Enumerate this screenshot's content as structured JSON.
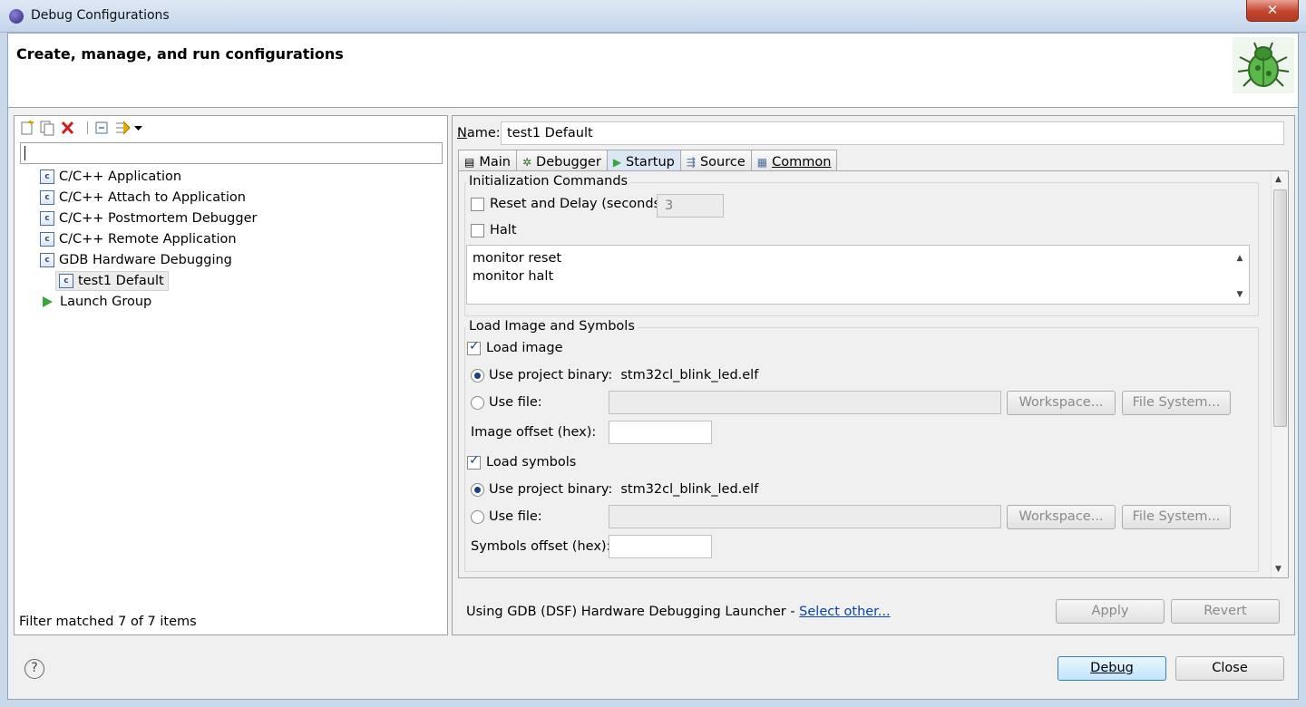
{
  "window": {
    "title": "Debug Configurations",
    "close_icon": "close-icon"
  },
  "banner": {
    "title": "Create, manage, and run configurations",
    "icon": "bug-icon"
  },
  "left_panel": {
    "toolbar": [
      "new-config-icon",
      "duplicate-icon",
      "delete-icon",
      "collapse-all-icon",
      "filter-icon",
      "dropdown-icon"
    ],
    "filter_value": "",
    "tree": [
      {
        "label": "C/C++ Application",
        "icon": "c-config-icon"
      },
      {
        "label": "C/C++ Attach to Application",
        "icon": "c-config-icon"
      },
      {
        "label": "C/C++ Postmortem Debugger",
        "icon": "c-config-icon"
      },
      {
        "label": "C/C++ Remote Application",
        "icon": "c-config-icon"
      },
      {
        "label": "GDB Hardware Debugging",
        "icon": "c-config-icon"
      },
      {
        "label": "test1 Default",
        "icon": "c-config-icon",
        "selected": true
      },
      {
        "label": "Launch Group",
        "icon": "launch-group-icon"
      }
    ],
    "status": "Filter matched 7 of 7 items"
  },
  "right_panel": {
    "name_label_mnemonic": "N",
    "name_label_rest": "ame:",
    "name_value": "test1 Default",
    "tabs": [
      {
        "label": "Main",
        "icon": "main-tab-icon"
      },
      {
        "label": "Debugger",
        "icon": "debugger-tab-icon"
      },
      {
        "label": "Startup",
        "icon": "startup-tab-icon",
        "active": true
      },
      {
        "label": "Source",
        "icon": "source-tab-icon"
      },
      {
        "label": "Common",
        "icon": "common-tab-icon"
      }
    ],
    "init": {
      "title": "Initialization Commands",
      "reset_label": "Reset and Delay (seconds):",
      "reset_checked": false,
      "delay_value": "3",
      "halt_label": "Halt",
      "halt_checked": false,
      "commands": [
        "monitor reset",
        "monitor halt"
      ]
    },
    "load": {
      "title": "Load Image and Symbols",
      "load_image_label": "Load image",
      "load_image_checked": true,
      "use_project_binary_label": "Use project binary:",
      "image_binary": "stm32cl_blink_led.elf",
      "use_file_label": "Use file:",
      "workspace_label": "Workspace...",
      "filesystem_label": "File System...",
      "image_offset_label": "Image offset (hex):",
      "image_offset_value": "",
      "load_symbols_label": "Load symbols",
      "load_symbols_checked": true,
      "symbols_binary": "stm32cl_blink_led.elf",
      "symbols_offset_label": "Symbols offset (hex):",
      "symbols_offset_value": ""
    },
    "launcher_text": "Using GDB (DSF) Hardware Debugging Launcher - ",
    "launcher_link": "Select other...",
    "apply_label": "Apply",
    "revert_label": "Revert"
  },
  "footer": {
    "help_icon": "help-icon",
    "debug_label": "Debug",
    "close_label": "Close"
  }
}
